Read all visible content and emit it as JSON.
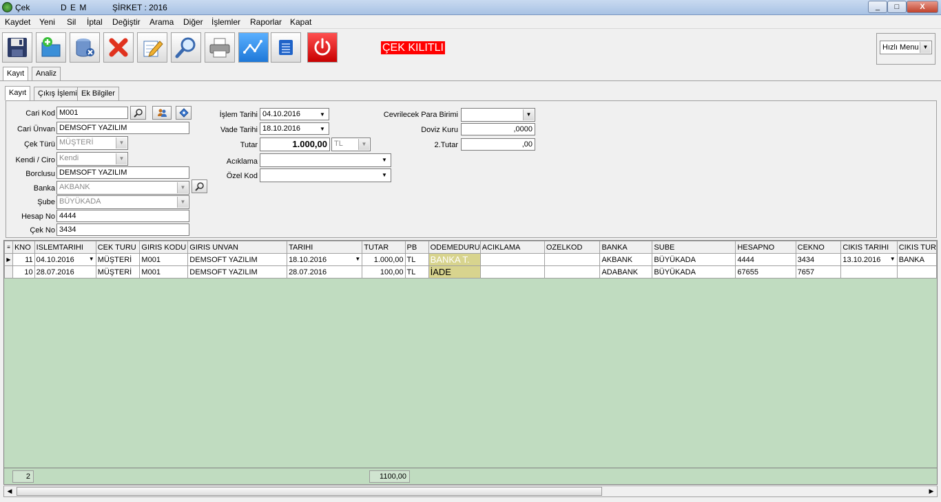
{
  "window": {
    "title": "Çek",
    "company_name": "D E M",
    "company_year": "ŞİRKET : 2016",
    "minimize": "_",
    "maximize": "□",
    "close": "X"
  },
  "menu": [
    "Kaydet",
    "Yeni",
    "Sil",
    "İptal",
    "Değiştir",
    "Arama",
    "Diğer",
    "İşlemler",
    "Raporlar",
    "Kapat"
  ],
  "toolbar": {
    "lock_label": "ÇEK KILITLI",
    "quick_menu": "Hızlı Menu",
    "icons": [
      "save-icon",
      "new-icon",
      "delete-db-icon",
      "cancel-icon",
      "edit-icon",
      "search-icon",
      "print-icon",
      "chart-icon",
      "list-icon",
      "power-icon"
    ]
  },
  "top_tabs": [
    "Kayıt",
    "Analiz"
  ],
  "sub_tabs": [
    "Kayıt",
    "Çıkış İşlemi",
    "Ek Bilgiler"
  ],
  "form": {
    "cari_kod": {
      "label": "Cari Kod",
      "value": "M001"
    },
    "cari_unvan": {
      "label": "Cari Ünvan",
      "value": "DEMSOFT YAZILIM"
    },
    "cek_turu": {
      "label": "Çek Türü",
      "value": "MÜŞTERİ"
    },
    "kendi_ciro": {
      "label": "Kendi / Ciro",
      "value": "Kendi"
    },
    "borclusu": {
      "label": "Borclusu",
      "value": "DEMSOFT YAZILIM"
    },
    "banka": {
      "label": "Banka",
      "value": "AKBANK"
    },
    "sube": {
      "label": "Şube",
      "value": "BÜYÜKADA"
    },
    "hesap_no": {
      "label": "Hesap No",
      "value": "4444"
    },
    "cek_no": {
      "label": "Çek No",
      "value": "3434"
    },
    "islem_tarihi": {
      "label": "İşlem Tarihi",
      "value": "04.10.2016"
    },
    "vade_tarihi": {
      "label": "Vade Tarihi",
      "value": "18.10.2016"
    },
    "tutar": {
      "label": "Tutar",
      "value": "1.000,00",
      "currency": "TL"
    },
    "aciklama": {
      "label": "Acıklama",
      "value": ""
    },
    "ozel_kod": {
      "label": "Özel Kod",
      "value": ""
    },
    "cevrilecek": {
      "label": "Cevrilecek Para Birimi",
      "value": ""
    },
    "doviz_kuru": {
      "label": "Doviz Kuru",
      "value": ",0000"
    },
    "tutar2": {
      "label": "2.Tutar",
      "value": ",00"
    }
  },
  "grid": {
    "columns": [
      "KNO",
      "ISLEMTARIHI",
      "CEK TURU",
      "GIRIS KODU",
      "GIRIS UNVAN",
      "TARIHI",
      "TUTAR",
      "PB",
      "ODEMEDURU",
      "ACIKLAMA",
      "OZELKOD",
      "BANKA",
      "SUBE",
      "HESAPNO",
      "CEKNO",
      "CIKIS TARIHI",
      "CIKIS TUR"
    ],
    "rows": [
      [
        "11",
        "04.10.2016",
        "MÜŞTERİ",
        "M001",
        "DEMSOFT YAZILIM",
        "18.10.2016",
        "1.000,00",
        "TL",
        "BANKA T.",
        "",
        "",
        "AKBANK",
        "BÜYÜKADA",
        "4444",
        "3434",
        "13.10.2016",
        "BANKA"
      ],
      [
        "10",
        "28.07.2016",
        "MÜŞTERİ",
        "M001",
        "DEMSOFT YAZILIM",
        "28.07.2016",
        "100,00",
        "TL",
        "İADE",
        "",
        "",
        "ADABANK",
        "BÜYÜKADA",
        "67655",
        "7657",
        "",
        ""
      ]
    ]
  },
  "footer": {
    "count": "2",
    "total": "1100,00"
  }
}
